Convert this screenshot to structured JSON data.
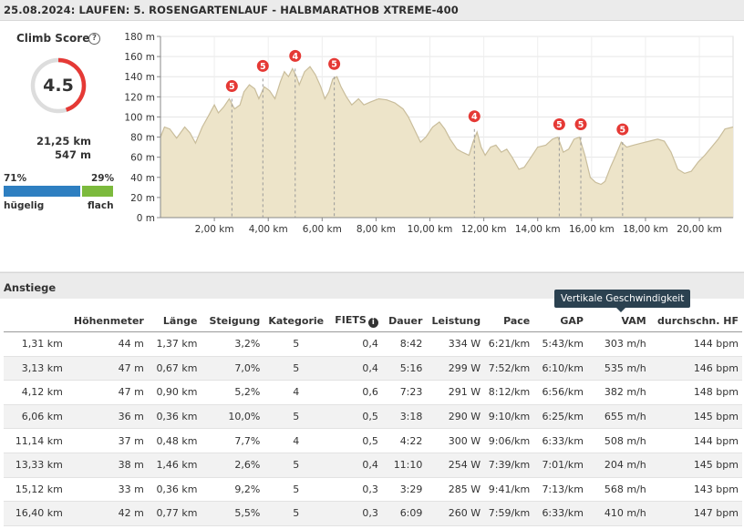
{
  "header": {
    "title": "25.08.2024: LAUFEN: 5. ROSENGARTENLAUF - HALBMARATHOB XTREME-400"
  },
  "climb_score": {
    "label": "Climb Score",
    "help_icon": "question-circle-icon",
    "score": "4.5",
    "score_fraction": 0.45,
    "distance": "21,25 km",
    "elevation_gain": "547 m",
    "hilly_pct": "71%",
    "flat_pct": "29%",
    "hilly_label": "hügelig",
    "flat_label": "flach",
    "hilly_fraction": 0.71,
    "colors": {
      "ring_fill": "#e53935",
      "ring_track": "#dddddd",
      "hilly": "#2e7fc1",
      "flat": "#7cba3d"
    }
  },
  "chart_data": {
    "type": "area",
    "x_unit": "km",
    "y_unit": "m",
    "xlim": [
      0,
      21.25
    ],
    "ylim": [
      0,
      180
    ],
    "y_ticks": [
      "0 m",
      "20 m",
      "40 m",
      "60 m",
      "80 m",
      "100 m",
      "120 m",
      "140 m",
      "160 m",
      "180 m"
    ],
    "y_tick_values": [
      0,
      20,
      40,
      60,
      80,
      100,
      120,
      140,
      160,
      180
    ],
    "x_ticks": [
      "2,00 km",
      "4,00 km",
      "6,00 km",
      "8,00 km",
      "10,00 km",
      "12,00 km",
      "14,00 km",
      "16,00 km",
      "18,00 km",
      "20,00 km"
    ],
    "x_tick_values": [
      2,
      4,
      6,
      8,
      10,
      12,
      14,
      16,
      18,
      20
    ],
    "grid": true,
    "fill_color": "#ede4c9",
    "line_color": "#c9bd9b",
    "profile": [
      [
        0.0,
        80
      ],
      [
        0.15,
        90
      ],
      [
        0.35,
        88
      ],
      [
        0.6,
        79
      ],
      [
        0.9,
        90
      ],
      [
        1.1,
        84
      ],
      [
        1.3,
        74
      ],
      [
        1.55,
        90
      ],
      [
        1.8,
        102
      ],
      [
        2.0,
        112
      ],
      [
        2.15,
        104
      ],
      [
        2.35,
        110
      ],
      [
        2.55,
        118
      ],
      [
        2.75,
        108
      ],
      [
        2.95,
        112
      ],
      [
        3.1,
        125
      ],
      [
        3.3,
        132
      ],
      [
        3.5,
        128
      ],
      [
        3.65,
        118
      ],
      [
        3.85,
        130
      ],
      [
        4.05,
        126
      ],
      [
        4.25,
        118
      ],
      [
        4.45,
        135
      ],
      [
        4.6,
        145
      ],
      [
        4.75,
        140
      ],
      [
        4.9,
        148
      ],
      [
        5.05,
        140
      ],
      [
        5.15,
        132
      ],
      [
        5.35,
        145
      ],
      [
        5.55,
        150
      ],
      [
        5.75,
        142
      ],
      [
        5.95,
        130
      ],
      [
        6.1,
        118
      ],
      [
        6.25,
        125
      ],
      [
        6.4,
        138
      ],
      [
        6.55,
        140
      ],
      [
        6.7,
        130
      ],
      [
        6.9,
        120
      ],
      [
        7.1,
        112
      ],
      [
        7.35,
        118
      ],
      [
        7.55,
        112
      ],
      [
        7.8,
        115
      ],
      [
        8.1,
        118
      ],
      [
        8.4,
        117
      ],
      [
        8.7,
        114
      ],
      [
        9.0,
        108
      ],
      [
        9.2,
        100
      ],
      [
        9.45,
        86
      ],
      [
        9.65,
        75
      ],
      [
        9.85,
        80
      ],
      [
        10.1,
        90
      ],
      [
        10.35,
        95
      ],
      [
        10.55,
        88
      ],
      [
        10.75,
        78
      ],
      [
        11.0,
        68
      ],
      [
        11.2,
        65
      ],
      [
        11.45,
        62
      ],
      [
        11.6,
        75
      ],
      [
        11.75,
        85
      ],
      [
        11.9,
        70
      ],
      [
        12.05,
        62
      ],
      [
        12.25,
        70
      ],
      [
        12.45,
        72
      ],
      [
        12.65,
        65
      ],
      [
        12.85,
        68
      ],
      [
        13.05,
        60
      ],
      [
        13.3,
        48
      ],
      [
        13.5,
        50
      ],
      [
        13.75,
        60
      ],
      [
        14.0,
        70
      ],
      [
        14.3,
        72
      ],
      [
        14.55,
        78
      ],
      [
        14.75,
        80
      ],
      [
        14.95,
        65
      ],
      [
        15.15,
        68
      ],
      [
        15.35,
        78
      ],
      [
        15.55,
        80
      ],
      [
        15.75,
        62
      ],
      [
        15.95,
        40
      ],
      [
        16.15,
        35
      ],
      [
        16.35,
        33
      ],
      [
        16.5,
        36
      ],
      [
        16.7,
        50
      ],
      [
        16.9,
        62
      ],
      [
        17.1,
        75
      ],
      [
        17.3,
        70
      ],
      [
        17.55,
        72
      ],
      [
        17.85,
        74
      ],
      [
        18.15,
        76
      ],
      [
        18.45,
        78
      ],
      [
        18.7,
        76
      ],
      [
        18.95,
        65
      ],
      [
        19.2,
        48
      ],
      [
        19.45,
        44
      ],
      [
        19.7,
        46
      ],
      [
        19.95,
        55
      ],
      [
        20.2,
        62
      ],
      [
        20.45,
        70
      ],
      [
        20.7,
        78
      ],
      [
        20.95,
        88
      ],
      [
        21.25,
        90
      ]
    ],
    "climb_markers": [
      {
        "x": 2.65,
        "y": 118,
        "category": "5"
      },
      {
        "x": 3.8,
        "y": 138,
        "category": "5"
      },
      {
        "x": 5.0,
        "y": 148,
        "category": "4"
      },
      {
        "x": 6.45,
        "y": 140,
        "category": "5"
      },
      {
        "x": 11.65,
        "y": 88,
        "category": "4"
      },
      {
        "x": 14.8,
        "y": 80,
        "category": "5"
      },
      {
        "x": 15.6,
        "y": 80,
        "category": "5"
      },
      {
        "x": 17.15,
        "y": 75,
        "category": "5"
      }
    ]
  },
  "climbs": {
    "section_title": "Anstiege",
    "tooltip": "Vertikale Geschwindigkeit",
    "info_icon": "info-circle-icon",
    "columns": [
      "",
      "Höhenmeter",
      "Länge",
      "Steigung",
      "Kategorie",
      "FIETS",
      "Dauer",
      "Leistung",
      "Pace",
      "GAP",
      "VAM",
      "durchschn. HF"
    ],
    "rows": [
      [
        "1,31 km",
        "44 m",
        "1,37 km",
        "3,2%",
        "5",
        "0,4",
        "8:42",
        "334 W",
        "6:21/km",
        "5:43/km",
        "303 m/h",
        "144 bpm"
      ],
      [
        "3,13 km",
        "47 m",
        "0,67 km",
        "7,0%",
        "5",
        "0,4",
        "5:16",
        "299 W",
        "7:52/km",
        "6:10/km",
        "535 m/h",
        "146 bpm"
      ],
      [
        "4,12 km",
        "47 m",
        "0,90 km",
        "5,2%",
        "4",
        "0,6",
        "7:23",
        "291 W",
        "8:12/km",
        "6:56/km",
        "382 m/h",
        "148 bpm"
      ],
      [
        "6,06 km",
        "36 m",
        "0,36 km",
        "10,0%",
        "5",
        "0,5",
        "3:18",
        "290 W",
        "9:10/km",
        "6:25/km",
        "655 m/h",
        "145 bpm"
      ],
      [
        "11,14 km",
        "37 m",
        "0,48 km",
        "7,7%",
        "4",
        "0,5",
        "4:22",
        "300 W",
        "9:06/km",
        "6:33/km",
        "508 m/h",
        "144 bpm"
      ],
      [
        "13,33 km",
        "38 m",
        "1,46 km",
        "2,6%",
        "5",
        "0,4",
        "11:10",
        "254 W",
        "7:39/km",
        "7:01/km",
        "204 m/h",
        "145 bpm"
      ],
      [
        "15,12 km",
        "33 m",
        "0,36 km",
        "9,2%",
        "5",
        "0,3",
        "3:29",
        "285 W",
        "9:41/km",
        "7:13/km",
        "568 m/h",
        "143 bpm"
      ],
      [
        "16,40 km",
        "42 m",
        "0,77 km",
        "5,5%",
        "5",
        "0,3",
        "6:09",
        "260 W",
        "7:59/km",
        "6:33/km",
        "410 m/h",
        "147 bpm"
      ]
    ]
  }
}
